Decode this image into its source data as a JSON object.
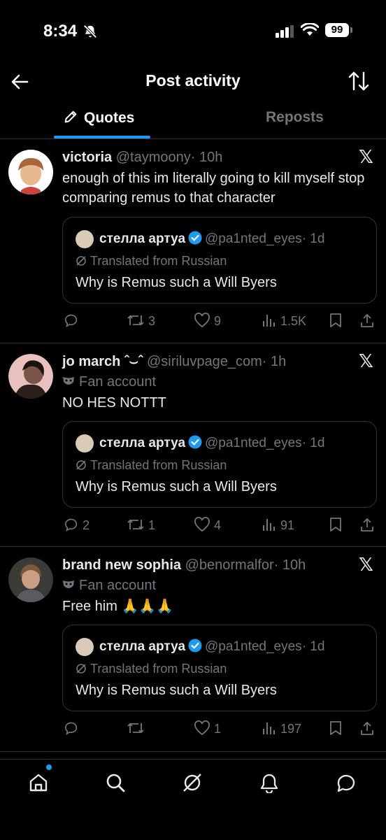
{
  "status": {
    "time": "8:34",
    "battery": "99"
  },
  "header": {
    "title": "Post activity"
  },
  "tabs": [
    {
      "label": "Quotes"
    },
    {
      "label": "Reposts"
    }
  ],
  "quoted_post": {
    "name": "стелла артуа",
    "handle": "@pa1nted_eyes",
    "time": "· 1d",
    "translated": "Translated from Russian",
    "text": "Why is Remus such a Will Byers"
  },
  "posts": [
    {
      "name": "victoria",
      "handle": "@taymoony",
      "time": "· 10h",
      "fan_account": "",
      "text": "enough of this im literally going to kill myself stop comparing remus to that character",
      "replies": "",
      "reposts": "3",
      "likes": "9",
      "views": "1.5K"
    },
    {
      "name": "jo march ˆ⌣ˆ",
      "handle": "@siriluvpage_com",
      "time": "· 1h",
      "fan_account": "Fan account",
      "text": "NO HES NOTTT",
      "replies": "2",
      "reposts": "1",
      "likes": "4",
      "views": "91"
    },
    {
      "name": "brand new sophia",
      "handle": "@benormalfor",
      "time": "· 10h",
      "fan_account": "Fan account",
      "text": "Free him 🙏🙏🙏",
      "replies": "",
      "reposts": "",
      "likes": "1",
      "views": "197"
    }
  ],
  "colors": {
    "accent": "#1d9bf0",
    "muted": "#71767b",
    "divider": "#2f3336"
  }
}
